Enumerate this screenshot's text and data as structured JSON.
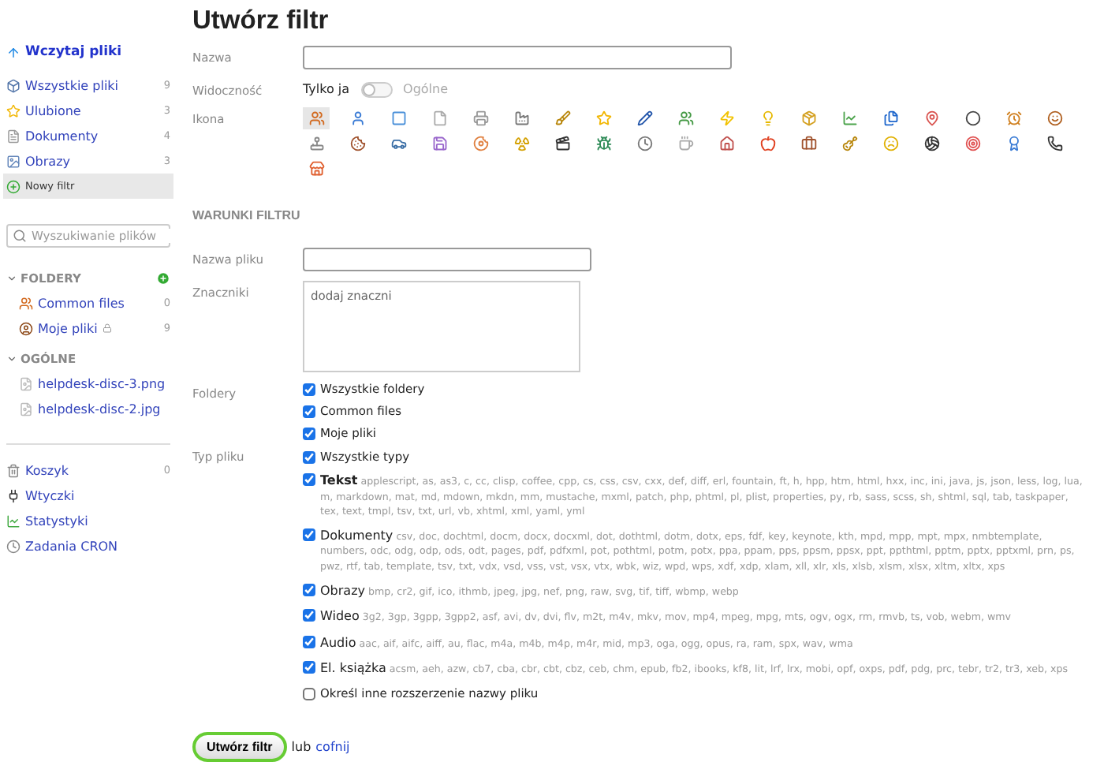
{
  "sidebar": {
    "upload": "Wczytaj pliki",
    "nav": [
      {
        "label": "Wszystkie pliki",
        "count": "9",
        "selected": false
      },
      {
        "label": "Ulubione",
        "count": "3",
        "selected": false
      },
      {
        "label": "Dokumenty",
        "count": "4",
        "selected": false
      },
      {
        "label": "Obrazy",
        "count": "3",
        "selected": false
      },
      {
        "label": "Nowy filtr",
        "selected": true
      }
    ],
    "search": {
      "placeholder": "Wyszukiwanie plików"
    },
    "folders": {
      "title": "FOLDERY",
      "items": [
        {
          "label": "Common files",
          "count": "0",
          "locked": false
        },
        {
          "label": "Moje pliki",
          "count": "9",
          "locked": true
        }
      ]
    },
    "general": {
      "title": "OGÓLNE",
      "items": [
        "helpdesk-disc-3.png",
        "helpdesk-disc-2.jpg"
      ]
    },
    "bottom": [
      {
        "label": "Koszyk",
        "count": "0"
      },
      {
        "label": "Wtyczki"
      },
      {
        "label": "Statystyki"
      },
      {
        "label": "Zadania CRON"
      }
    ]
  },
  "title": "Utwórz filtr",
  "name_label": "Nazwa",
  "visibility": {
    "label": "Widoczność",
    "on": false,
    "options": [
      {
        "label": "Tylko ja",
        "selected": true
      },
      {
        "label": "Ogólne",
        "selected": false
      }
    ]
  },
  "icon_label": "Ikona",
  "icons": [
    {
      "selected": true
    },
    {
      "selected": false
    },
    {
      "selected": false
    },
    {
      "selected": false
    },
    {
      "selected": false
    },
    {
      "selected": false
    },
    {
      "selected": false
    },
    {
      "selected": false
    },
    {
      "selected": false
    },
    {
      "selected": false
    },
    {
      "selected": false
    },
    {
      "selected": false
    },
    {
      "selected": false
    },
    {
      "selected": false
    },
    {
      "selected": false
    },
    {
      "selected": false
    },
    {
      "selected": false
    },
    {
      "selected": false
    },
    {
      "selected": false
    },
    {
      "selected": false
    },
    {
      "selected": false
    },
    {
      "selected": false
    },
    {
      "selected": false
    },
    {
      "selected": false
    },
    {
      "selected": false
    },
    {
      "selected": false
    },
    {
      "selected": false
    },
    {
      "selected": false
    },
    {
      "selected": false
    },
    {
      "selected": false
    },
    {
      "selected": false
    },
    {
      "selected": false
    },
    {
      "selected": false
    },
    {
      "selected": false
    },
    {
      "selected": false
    },
    {
      "selected": false
    },
    {
      "selected": false
    },
    {
      "selected": false
    },
    {
      "selected": false
    }
  ],
  "conditions_title": "WARUNKI FILTRU",
  "filename_label": "Nazwa pliku",
  "tags": {
    "label": "Znaczniki",
    "placeholder": "dodaj znaczni"
  },
  "folders": {
    "label": "Foldery",
    "items": [
      {
        "label": "Wszystkie foldery",
        "checked": true
      },
      {
        "label": "Common files",
        "checked": true
      },
      {
        "label": "Moje pliki",
        "checked": true
      }
    ]
  },
  "types": {
    "label": "Typ pliku",
    "all": {
      "label": "Wszystkie typy",
      "checked": true
    },
    "items": [
      {
        "label": "Tekst",
        "checked": true,
        "extensions": "applescript, as, as3, c, cc, clisp, coffee, cpp, cs, css, csv, cxx, def, diff, erl, fountain, ft, h, hpp, htm, html, hxx, inc, ini, java, js, json, less, log, lua, m, markdown, mat, md, mdown, mkdn, mm, mustache, mxml, patch, php, phtml, pl, plist, properties, py, rb, sass, scss, sh, shtml, sql, tab, taskpaper, tex, text, tmpl, tsv, txt, url, vb, xhtml, xml, yaml, yml"
      },
      {
        "label": "Dokumenty",
        "checked": true,
        "extensions": "csv, doc, dochtml, docm, docx, docxml, dot, dothtml, dotm, dotx, eps, fdf, key, keynote, kth, mpd, mpp, mpt, mpx, nmbtemplate, numbers, odc, odg, odp, ods, odt, pages, pdf, pdfxml, pot, pothtml, potm, potx, ppa, ppam, pps, ppsm, ppsx, ppt, ppthtml, pptm, pptx, pptxml, prn, ps, pwz, rtf, tab, template, tsv, txt, vdx, vsd, vss, vst, vsx, vtx, wbk, wiz, wpd, wps, xdf, xdp, xlam, xll, xlr, xls, xlsb, xlsm, xlsx, xltm, xltx, xps"
      },
      {
        "label": "Obrazy",
        "checked": true,
        "extensions": "bmp, cr2, gif, ico, ithmb, jpeg, jpg, nef, png, raw, svg, tif, tiff, wbmp, webp"
      },
      {
        "label": "Wideo",
        "checked": true,
        "extensions": "3g2, 3gp, 3gpp, 3gpp2, asf, avi, dv, dvi, flv, m2t, m4v, mkv, mov, mp4, mpeg, mpg, mts, ogv, ogx, rm, rmvb, ts, vob, webm, wmv"
      },
      {
        "label": "Audio",
        "checked": true,
        "extensions": "aac, aif, aifc, aiff, au, flac, m4a, m4b, m4p, m4r, mid, mp3, oga, ogg, opus, ra, ram, spx, wav, wma"
      },
      {
        "label": "El. książka",
        "checked": true,
        "extensions": "acsm, aeh, azw, cb7, cba, cbr, cbt, cbz, ceb, chm, epub, fb2, ibooks, kf8, lit, lrf, lrx, mobi, opf, oxps, pdf, pdg, prc, tebr, tr2, tr3, xeb, xps"
      }
    ],
    "other": {
      "label": "Określ inne rozszerzenie nazwy pliku",
      "checked": false
    }
  },
  "submit": "Utwórz filtr",
  "or": "lub",
  "cancel": "cofnij"
}
